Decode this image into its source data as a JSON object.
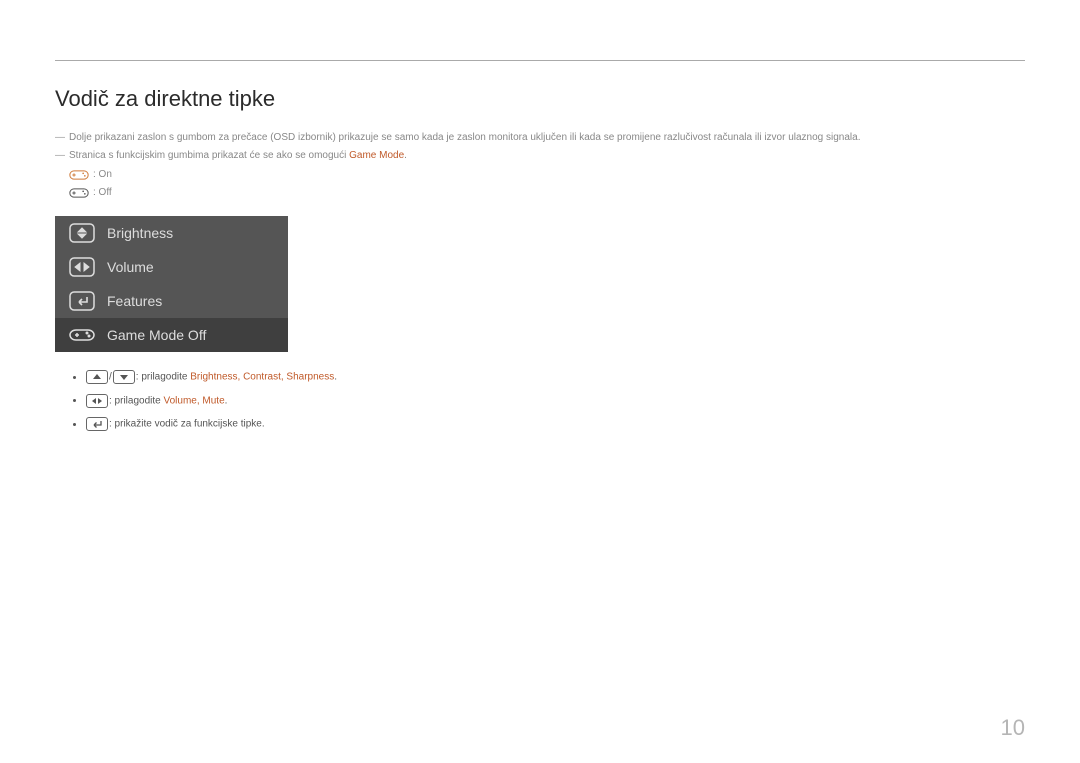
{
  "title": "Vodič za direktne tipke",
  "notes": {
    "line1": "Dolje prikazani zaslon s gumbom za prečace (OSD izbornik) prikazuje se samo kada je zaslon monitora uključen ili kada se promijene razlučivost računala ili izvor ulaznog signala.",
    "line2_prefix": "Stranica s funkcijskim gumbima prikazat će se ako se omogući ",
    "line2_kw": "Game Mode",
    "line2_suffix": "."
  },
  "legend": {
    "on": ": On",
    "off": ": Off"
  },
  "osd": {
    "row1": "Brightness",
    "row2": "Volume",
    "row3": "Features",
    "row4": "Game Mode Off"
  },
  "bullets": {
    "b1_prefix": ": prilagodite ",
    "b1_kw": "Brightness, Contrast, Sharpness",
    "b1_suffix": ".",
    "b2_prefix": ": prilagodite ",
    "b2_kw": "Volume, Mute",
    "b2_suffix": ".",
    "b3": ": prikažite vodič za funkcijske tipke."
  },
  "page_number": "10"
}
